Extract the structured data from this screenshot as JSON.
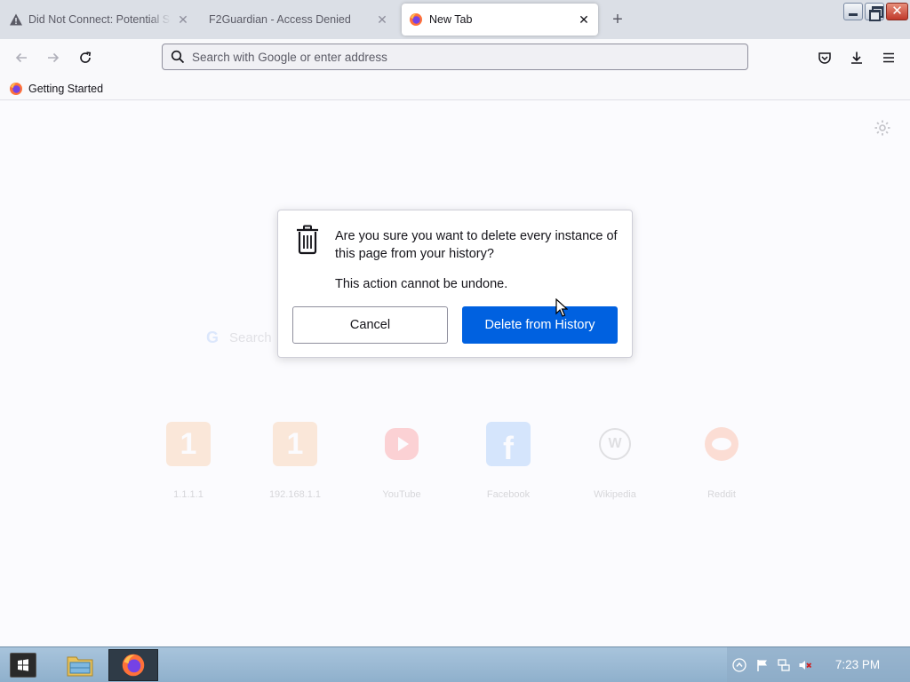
{
  "browser": {
    "tabs": [
      {
        "title": "Did Not Connect: Potential Security Issue",
        "icon": "warning-icon",
        "active": false
      },
      {
        "title": "F2Guardian - Access Denied",
        "icon": "",
        "active": false
      },
      {
        "title": "New Tab",
        "icon": "firefox-icon",
        "active": true
      }
    ],
    "address_bar": {
      "placeholder": "Search with Google or enter address",
      "value": ""
    },
    "bookmarks": [
      {
        "label": "Getting Started",
        "icon": "firefox-icon"
      }
    ]
  },
  "new_tab_page": {
    "search_placeholder": "Search",
    "top_sites": [
      {
        "label": "1.1.1.1",
        "icon": "cloudflare-icon"
      },
      {
        "label": "192.168.1.1",
        "icon": "cloudflare-icon"
      },
      {
        "label": "YouTube",
        "icon": "youtube-icon"
      },
      {
        "label": "Facebook",
        "icon": "facebook-icon"
      },
      {
        "label": "Wikipedia",
        "icon": "wikipedia-icon"
      },
      {
        "label": "Reddit",
        "icon": "reddit-icon"
      }
    ]
  },
  "dialog": {
    "message": "Are you sure you want to delete every instance of this page from your history?",
    "warning": "This action cannot be undone.",
    "cancel_label": "Cancel",
    "confirm_label": "Delete from History",
    "accent_color": "#0061e0"
  },
  "taskbar": {
    "clock": "7:23 PM",
    "apps": [
      "file-explorer",
      "firefox"
    ]
  }
}
